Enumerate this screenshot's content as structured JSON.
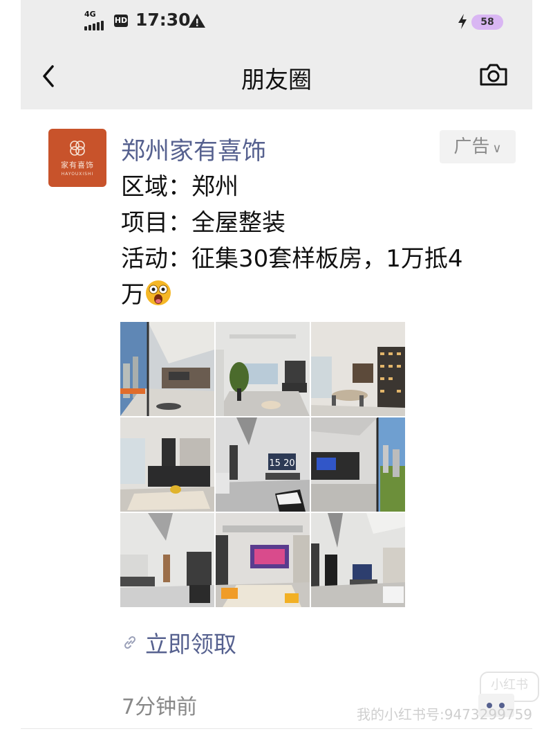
{
  "status_bar": {
    "network": "4G",
    "hd_label": "HD",
    "time": "17:30",
    "battery": "58"
  },
  "nav": {
    "title": "朋友圈"
  },
  "post": {
    "author": "郑州家有喜饰",
    "avatar_text": "家有喜饰",
    "avatar_subtext": "HAYOUXISHI",
    "ad_label": "广告",
    "lines": [
      "区域：郑州",
      "项目：全屋整装",
      "活动：征集30套样板房，1万抵4",
      "万"
    ],
    "tv_display": "15 20",
    "link_label": "立即领取",
    "timestamp": "7分钟前"
  },
  "watermark": {
    "logo": "小红书",
    "text": "我的小红书号:9473299759"
  },
  "colors": {
    "link_blue": "#56618f",
    "avatar_bg": "#c8532b",
    "topbar_bg": "#ededed"
  },
  "icons": [
    "back-icon",
    "camera-icon",
    "warning-icon",
    "bolt-icon",
    "chevron-down-icon",
    "link-icon",
    "more-icon",
    "emoji-icon"
  ]
}
